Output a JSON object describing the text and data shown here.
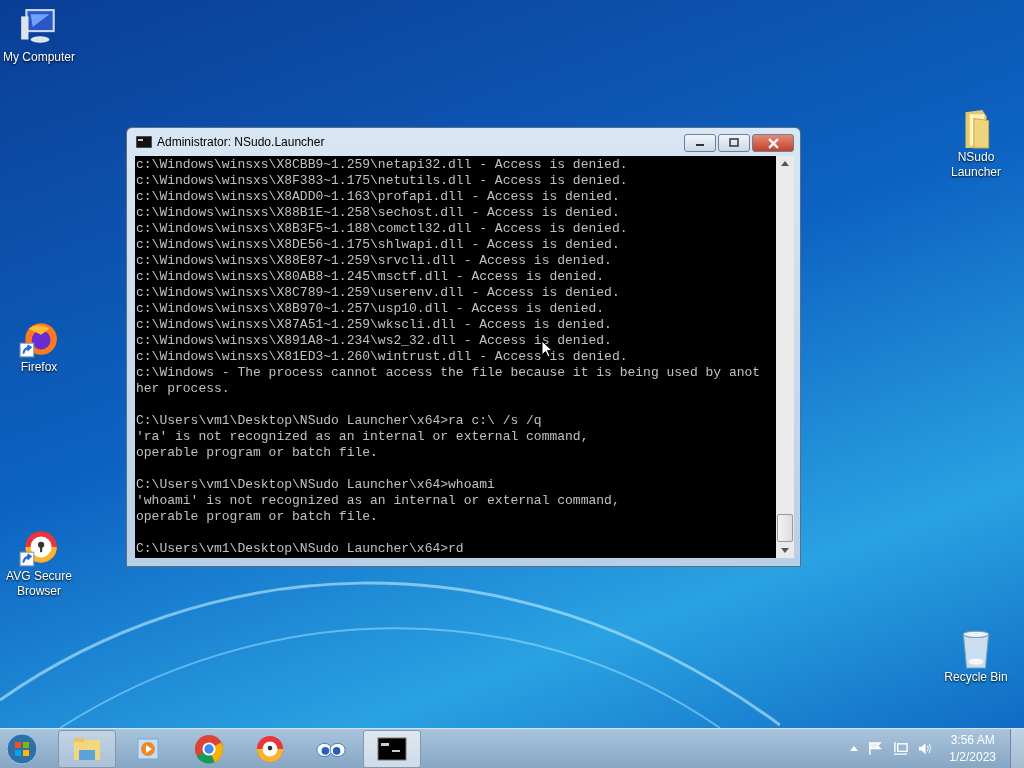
{
  "desktop_icons_left": [
    {
      "kind": "computer",
      "label": "My Computer",
      "shortcut": false
    },
    {
      "kind": "firefox",
      "label": "Firefox",
      "shortcut": true
    },
    {
      "kind": "avg",
      "label": "AVG Secure Browser",
      "shortcut": true
    }
  ],
  "desktop_icons_right": [
    {
      "kind": "folder",
      "label": "NSudo Launcher",
      "shortcut": false
    },
    {
      "kind": "recycle",
      "label": "Recycle Bin",
      "shortcut": false
    }
  ],
  "window": {
    "title": "Administrator: NSudo.Launcher",
    "console_blocks": [
      [
        "c:\\Windows\\winsxs\\X8CBB9~1.259\\netapi32.dll - Access is denied.",
        "c:\\Windows\\winsxs\\X8F383~1.175\\netutils.dll - Access is denied.",
        "c:\\Windows\\winsxs\\X8ADD0~1.163\\profapi.dll - Access is denied.",
        "c:\\Windows\\winsxs\\X88B1E~1.258\\sechost.dll - Access is denied.",
        "c:\\Windows\\winsxs\\X8B3F5~1.188\\comctl32.dll - Access is denied.",
        "c:\\Windows\\winsxs\\X8DE56~1.175\\shlwapi.dll - Access is denied.",
        "c:\\Windows\\winsxs\\X88E87~1.259\\srvcli.dll - Access is denied.",
        "c:\\Windows\\winsxs\\X80AB8~1.245\\msctf.dll - Access is denied.",
        "c:\\Windows\\winsxs\\X8C789~1.259\\userenv.dll - Access is denied.",
        "c:\\Windows\\winsxs\\X8B970~1.257\\usp10.dll - Access is denied.",
        "c:\\Windows\\winsxs\\X87A51~1.259\\wkscli.dll - Access is denied.",
        "c:\\Windows\\winsxs\\X891A8~1.234\\ws2_32.dll - Access is denied.",
        "c:\\Windows\\winsxs\\X81ED3~1.260\\wintrust.dll - Access is denied.",
        "c:\\Windows - The process cannot access the file because it is being used by anot",
        "her process."
      ],
      [
        "C:\\Users\\vm1\\Desktop\\NSudo Launcher\\x64>ra c:\\ /s /q",
        "'ra' is not recognized as an internal or external command,",
        "operable program or batch file."
      ],
      [
        "C:\\Users\\vm1\\Desktop\\NSudo Launcher\\x64>whoami",
        "'whoami' is not recognized as an internal or external command,",
        "operable program or batch file."
      ],
      [
        "C:\\Users\\vm1\\Desktop\\NSudo Launcher\\x64>rd"
      ]
    ]
  },
  "taskbar": {
    "items": [
      {
        "kind": "explorer",
        "running": true,
        "selected": false
      },
      {
        "kind": "media",
        "running": false,
        "selected": false
      },
      {
        "kind": "chrome",
        "running": false,
        "selected": false
      },
      {
        "kind": "avg",
        "running": false,
        "selected": false
      },
      {
        "kind": "eyes",
        "running": false,
        "selected": false
      },
      {
        "kind": "console",
        "running": true,
        "selected": true
      }
    ],
    "clock": {
      "time": "3:56 AM",
      "date": "1/2/2023"
    }
  }
}
